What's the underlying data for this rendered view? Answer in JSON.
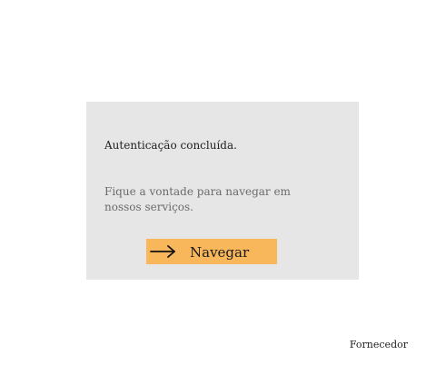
{
  "card": {
    "title": "Autenticação concluída.",
    "message": "Fique a vontade para navegar em nossos serviços.",
    "button_label": "Navegar",
    "button_icon": "arrow-right-icon",
    "background_color": "#e6e6e6",
    "button_color": "#f7b75a"
  },
  "footer": {
    "provider_label": "Fornecedor"
  }
}
